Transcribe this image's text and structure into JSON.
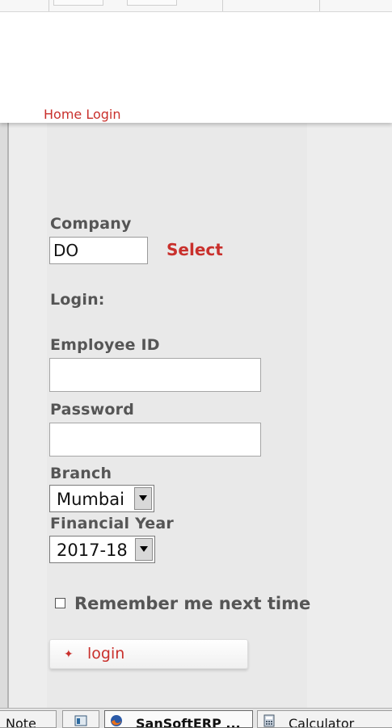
{
  "header": {
    "breadcrumb": "Home Login"
  },
  "form": {
    "company_label": "Company",
    "company_value": "DO",
    "select_link": "Select",
    "login_heading": "Login:",
    "employee_id_label": "Employee ID",
    "employee_id_value": "",
    "password_label": "Password",
    "password_value": "",
    "branch_label": "Branch",
    "branch_value": "Mumbai",
    "financial_year_label": "Financial Year",
    "financial_year_value": "2017-18",
    "remember_label": "Remember me next time",
    "remember_checked": false,
    "login_button": "login"
  },
  "taskbar": {
    "items": [
      {
        "label": "Note"
      },
      {
        "label": ""
      },
      {
        "label": "SanSoftERP ..."
      },
      {
        "label": "Calculator"
      }
    ]
  },
  "colors": {
    "accent": "#c9302c",
    "label_gray": "#555555",
    "panel": "#e9e9e9"
  },
  "icons": [
    "bullet-icon",
    "chevron-down-icon",
    "firefox-icon",
    "calculator-icon",
    "window-icon"
  ]
}
